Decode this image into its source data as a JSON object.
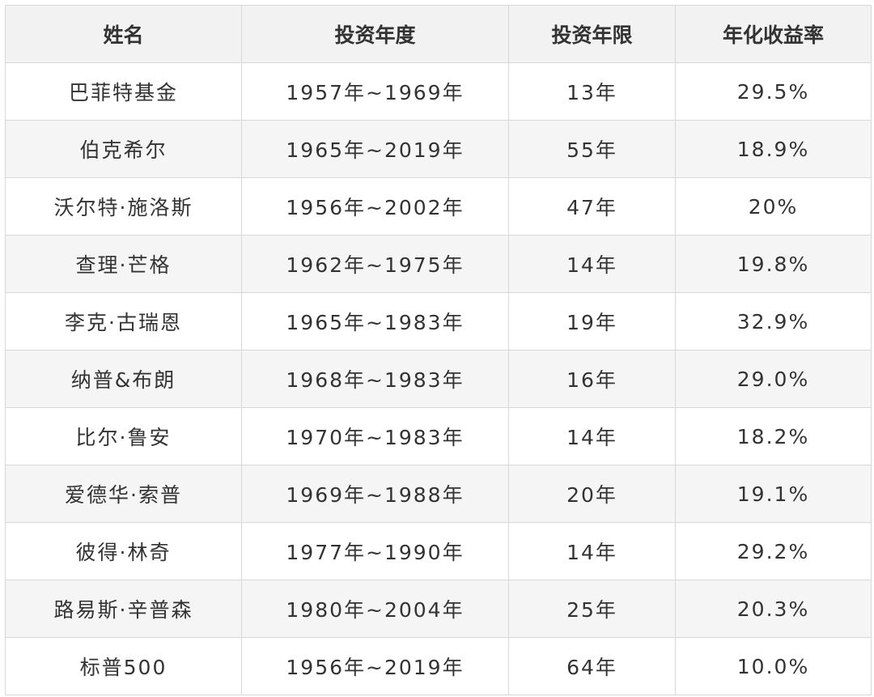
{
  "table": {
    "headers": [
      "姓名",
      "投资年度",
      "投资年限",
      "年化收益率"
    ],
    "rows": [
      [
        "巴菲特基金",
        "1957年~1969年",
        "13年",
        "29.5%"
      ],
      [
        "伯克希尔",
        "1965年~2019年",
        "55年",
        "18.9%"
      ],
      [
        "沃尔特·施洛斯",
        "1956年~2002年",
        "47年",
        "20%"
      ],
      [
        "查理·芒格",
        "1962年~1975年",
        "14年",
        "19.8%"
      ],
      [
        "李克·古瑞恩",
        "1965年~1983年",
        "19年",
        "32.9%"
      ],
      [
        "纳普&布朗",
        "1968年~1983年",
        "16年",
        "29.0%"
      ],
      [
        "比尔·鲁安",
        "1970年~1983年",
        "14年",
        "18.2%"
      ],
      [
        "爱德华·索普",
        "1969年~1988年",
        "20年",
        "19.1%"
      ],
      [
        "彼得·林奇",
        "1977年~1990年",
        "14年",
        "29.2%"
      ],
      [
        "路易斯·辛普森",
        "1980年~2004年",
        "25年",
        "20.3%"
      ],
      [
        "标普500",
        "1956年~2019年",
        "64年",
        "10.0%"
      ]
    ]
  }
}
